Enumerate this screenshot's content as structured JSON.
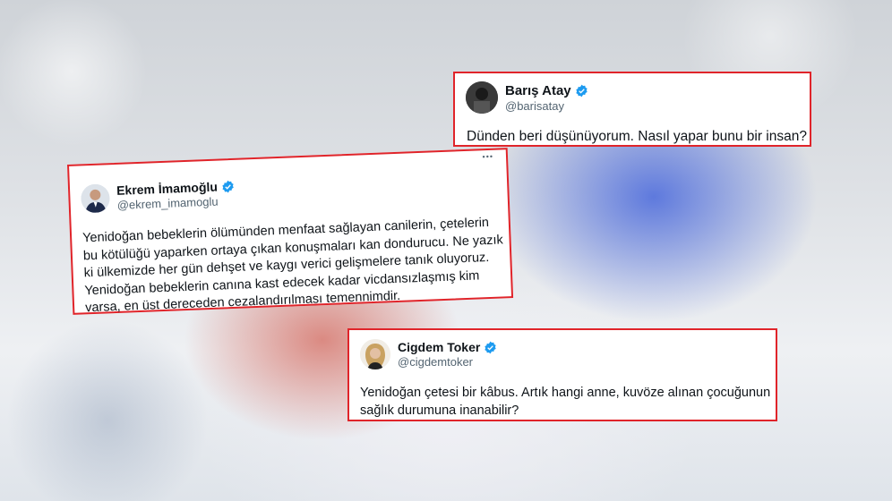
{
  "tweets": [
    {
      "name": "Barış Atay",
      "handle": "@barisatay",
      "text": "Dünden beri düşünüyorum. Nasıl yapar bunu bir insan?"
    },
    {
      "name": "Ekrem İmamoğlu",
      "handle": "@ekrem_imamoglu",
      "more": "•••",
      "lines": [
        "Yenidoğan bebeklerin ölümünden menfaat sağlayan canilerin, çetelerin",
        "bu kötülüğü yaparken ortaya çıkan konuşmaları kan dondurucu. Ne yazık",
        "ki ülkemizde her gün dehşet ve kaygı verici gelişmelere tanık oluyoruz.",
        "Yenidoğan bebeklerin canına kast edecek kadar vicdansızlaşmış kim",
        "varsa, en üst dereceden cezalandırılması temennimdir."
      ]
    },
    {
      "name": "Cigdem Toker",
      "handle": "@cigdemtoker",
      "lines": [
        "Yenidoğan çetesi bir kâbus. Artık hangi anne, kuvöze alınan çocuğunun",
        "sağlık durumuna inanabilir?"
      ]
    }
  ],
  "colors": {
    "frame": "#e0242a",
    "verified": "#1d9bf0"
  },
  "icons": {
    "verified": "verified-badge-icon"
  }
}
